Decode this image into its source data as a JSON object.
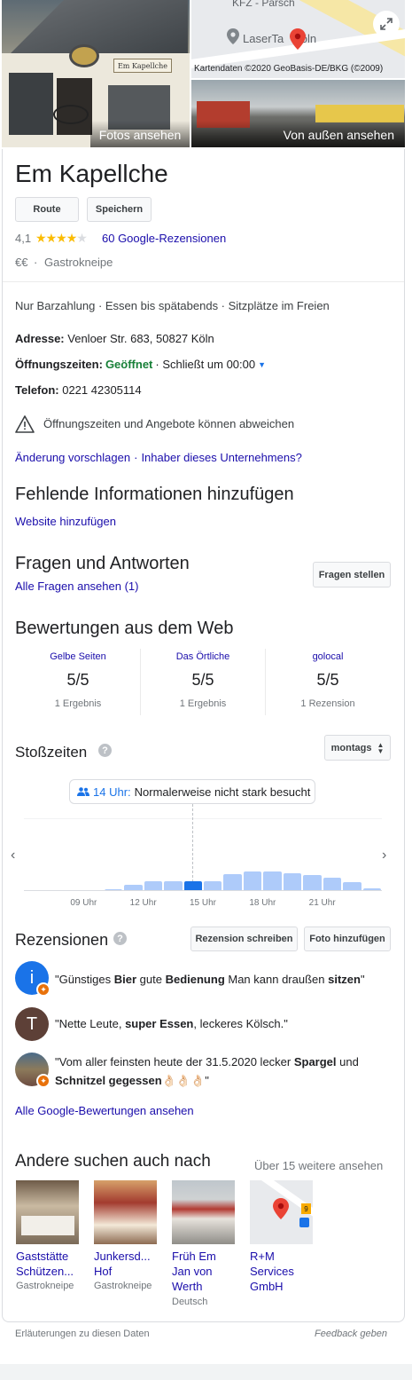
{
  "photos": {
    "photos_label": "Fotos ansehen",
    "outside_label": "Von außen ansehen",
    "sign_text": "Em Kapellche",
    "map_top_label": "KFZ - Parsch",
    "map_place_label": "LaserTa   Köln",
    "map_credit": "Kartendaten ©2020 GeoBasis-DE/BKG (©2009)",
    "expand_icon": "expand-icon"
  },
  "business": {
    "name": "Em Kapellche",
    "route_label": "Route",
    "save_label": "Speichern",
    "rating": "4,1",
    "stars_filled": 4,
    "reviews_link": "60 Google-Rezensionen",
    "price": "€€",
    "separator": "·",
    "category": "Gastrokneipe"
  },
  "info": {
    "attributes": "Nur Barzahlung · Essen bis spätabends · Sitzplätze im Freien",
    "address_label": "Adresse:",
    "address_value": "Venloer Str. 683, 50827 Köln",
    "hours_label": "Öffnungszeiten:",
    "hours_status": "Geöffnet",
    "hours_close": "· Schließt um 00:00",
    "phone_label": "Telefon:",
    "phone_value": "0221 42305114",
    "warning": "Öffnungszeiten und Angebote können abweichen",
    "suggest_edit": "Änderung vorschlagen",
    "owner_link": "Inhaber dieses Unternehmens?",
    "dot": "·"
  },
  "missing": {
    "title": "Fehlende Informationen hinzufügen",
    "add_website": "Website hinzufügen"
  },
  "qa": {
    "title": "Fragen und Antworten",
    "all_link": "Alle Fragen ansehen (1)",
    "ask_button": "Fragen stellen"
  },
  "web_reviews": {
    "title": "Bewertungen aus dem Web",
    "sources": [
      {
        "name": "Gelbe Seiten",
        "score": "5/5",
        "count": "1 Ergebnis"
      },
      {
        "name": "Das Örtliche",
        "score": "5/5",
        "count": "1 Ergebnis"
      },
      {
        "name": "golocal",
        "score": "5/5",
        "count": "1 Rezension"
      }
    ]
  },
  "popular_times": {
    "title": "Stoßzeiten",
    "day_select": "montags",
    "live_time": "14 Uhr:",
    "live_text": "Normalerweise nicht stark besucht",
    "ticks": [
      "09 Uhr",
      "12 Uhr",
      "15 Uhr",
      "18 Uhr",
      "21 Uhr"
    ],
    "busyness": [
      0,
      0,
      0,
      0,
      2,
      7,
      11,
      11,
      11,
      11,
      19,
      22,
      22,
      20,
      18,
      15,
      10,
      3
    ],
    "current_index": 8,
    "bar_color": "#aecbfa",
    "current_color": "#1a73e8"
  },
  "reviews": {
    "title": "Rezensionen",
    "write_button": "Rezension schreiben",
    "photo_button": "Foto hinzufügen",
    "items": [
      {
        "avatar_letter": "i",
        "avatar_color": "#1a73e8",
        "quote_html": "\"Günstiges <b>Bier</b> gute <b>Bedienung</b> Man kann draußen <b>sitzen</b>\""
      },
      {
        "avatar_letter": "T",
        "avatar_color": "#5d4037",
        "quote_html": "\"Nette Leute, <b>super Essen</b>, leckeres Kölsch.\""
      },
      {
        "avatar_letter": "",
        "avatar_color": "#6d4c41",
        "quote_html": "\"Vom aller feinsten heute der 31.5.2020 lecker <b>Spargel</b> und <b>Schnitzel gegessen</b>👌🏻👌🏻👌🏻\""
      }
    ],
    "all_link": "Alle Google-Bewertungen ansehen"
  },
  "others": {
    "title": "Andere suchen auch nach",
    "more_link": "Über 15 weitere ansehen",
    "items": [
      {
        "name": "Gaststätte Schützen...",
        "type": "Gastrokneipe"
      },
      {
        "name": "Junkersd... Hof",
        "type": "Gastrokneipe"
      },
      {
        "name": "Früh Em Jan von Werth",
        "type": "Deutsch"
      },
      {
        "name": "R+M Services GmbH",
        "type": ""
      }
    ]
  },
  "footer": {
    "explain": "Erläuterungen zu diesen Daten",
    "feedback": "Feedback geben"
  }
}
